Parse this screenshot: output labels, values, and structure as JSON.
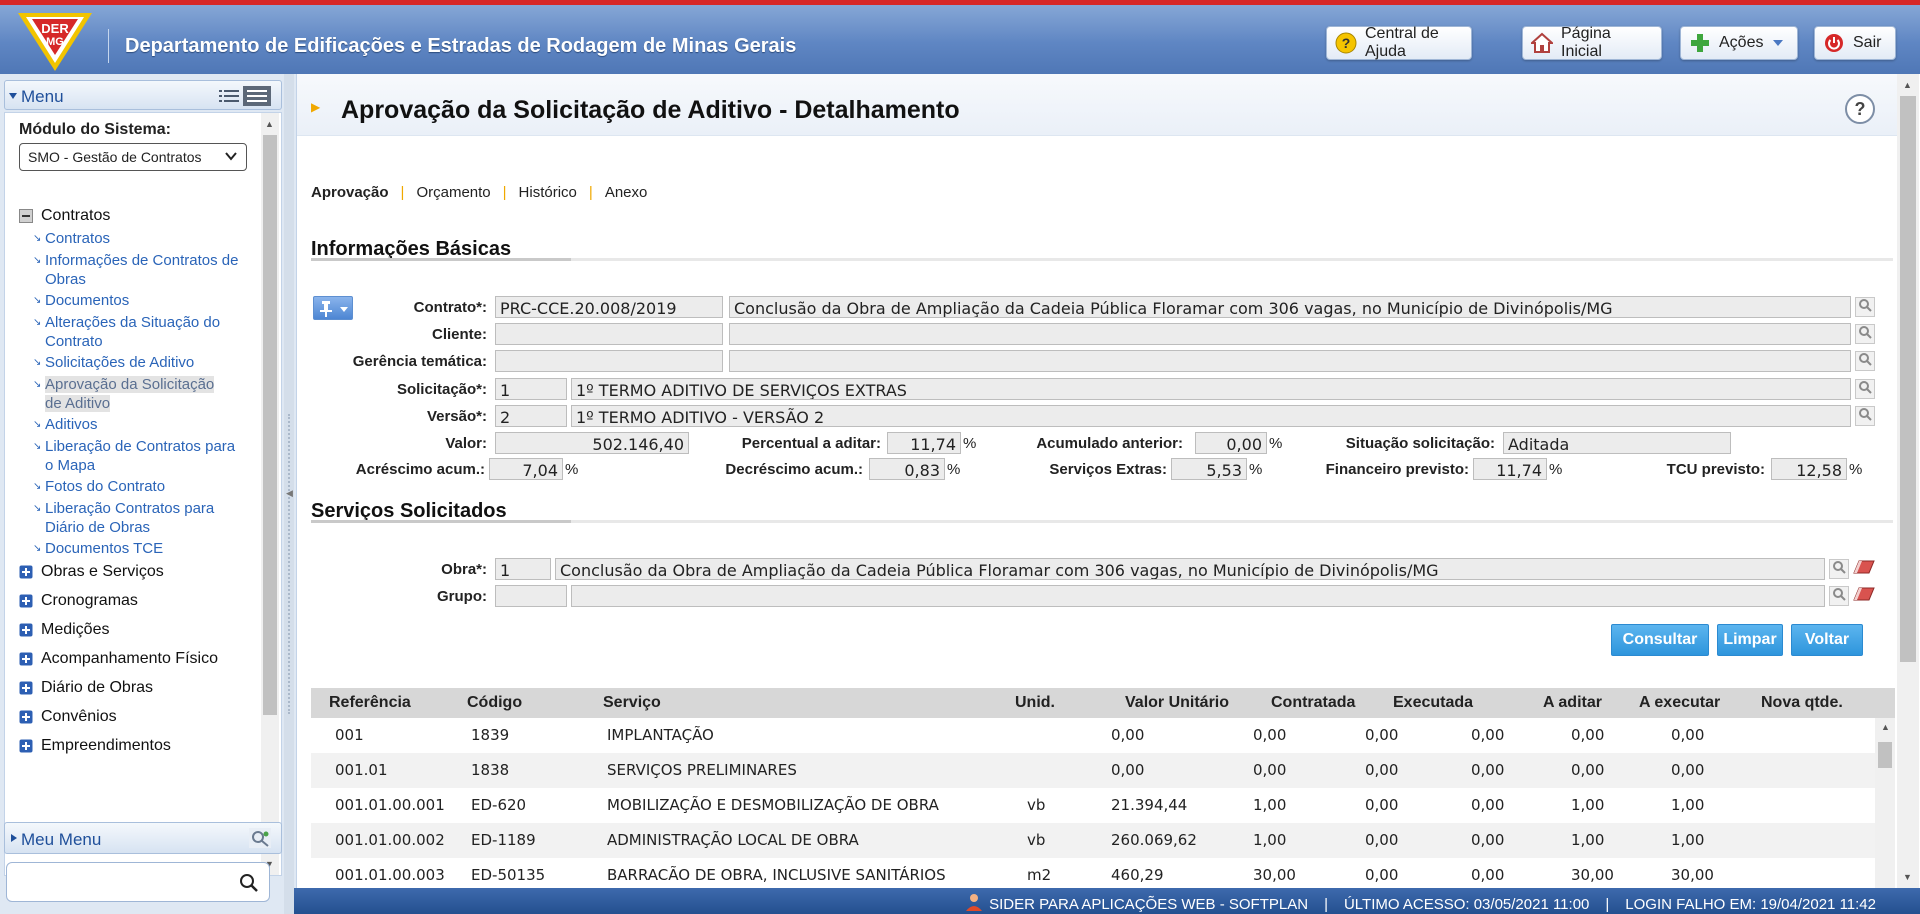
{
  "header": {
    "logo_text_top": "DER",
    "logo_text_bottom": "MG",
    "title": "Departamento de Edificações e Estradas de Rodagem de Minas Gerais",
    "buttons": {
      "help": "Central de Ajuda",
      "home": "Página Inicial",
      "actions": "Ações",
      "logout": "Sair"
    }
  },
  "sidebar": {
    "menu_title": "Menu",
    "module_label": "Módulo do Sistema:",
    "module_value": "SMO - Gestão de Contratos",
    "categories": {
      "contratos": "Contratos",
      "obras": "Obras e Serviços",
      "cronogramas": "Cronogramas",
      "medicoes": "Medições",
      "acompanhamento": "Acompanhamento Físico",
      "diario": "Diário de Obras",
      "convenios": "Convênios",
      "empreendimentos": "Empreendimentos"
    },
    "items": [
      "Contratos",
      "Informações de Contratos de Obras",
      "Documentos",
      "Alterações da Situação do Contrato",
      "Solicitações de Aditivo",
      "Aprovação da Solicitação de Aditivo",
      "Aditivos",
      "Liberação de Contratos para o Mapa",
      "Fotos do Contrato",
      "Liberação Contratos para Diário de Obras",
      "Documentos TCE"
    ],
    "meu_menu": "Meu Menu",
    "search_placeholder": ""
  },
  "page": {
    "title": "Aprovação da Solicitação de Aditivo - Detalhamento",
    "help": "?",
    "tabs": [
      "Aprovação",
      "Orçamento",
      "Histórico",
      "Anexo"
    ],
    "section_basic": "Informações Básicas",
    "section_services": "Serviços Solicitados"
  },
  "form": {
    "contrato_label": "Contrato*:",
    "contrato_code": "PRC-CCE.20.008/2019",
    "contrato_desc": "Conclusão da Obra de Ampliação da Cadeia Pública Floramar com 306 vagas, no Município de Divinópolis/MG",
    "cliente_label": "Cliente:",
    "gerencia_label": "Gerência temática:",
    "solicitacao_label": "Solicitação*:",
    "solicitacao_num": "1",
    "solicitacao_desc": "1º TERMO ADITIVO DE SERVIÇOS EXTRAS",
    "versao_label": "Versão*:",
    "versao_num": "2",
    "versao_desc": "1º TERMO ADITIVO - VERSÃO 2",
    "valor_label": "Valor:",
    "valor": "502.146,40",
    "percentual_label": "Percentual a aditar:",
    "percentual": "11,74",
    "acumulado_label": "Acumulado anterior:",
    "acumulado": "0,00",
    "situacao_label": "Situação solicitação:",
    "situacao": "Aditada",
    "acrescimo_label": "Acréscimo acum.:",
    "acrescimo": "7,04",
    "decrescimo_label": "Decréscimo acum.:",
    "decrescimo": "0,83",
    "servicos_label": "Serviços Extras:",
    "servicos": "5,53",
    "financeiro_label": "Financeiro previsto:",
    "financeiro": "11,74",
    "tcu_label": "TCU previsto:",
    "tcu": "12,58",
    "pct_sign": "%",
    "obra_label": "Obra*:",
    "obra_num": "1",
    "obra_desc": "Conclusão da Obra de Ampliação da Cadeia Pública Floramar com 306 vagas, no Município de Divinópolis/MG",
    "grupo_label": "Grupo:",
    "btn_consultar": "Consultar",
    "btn_limpar": "Limpar",
    "btn_voltar": "Voltar"
  },
  "table": {
    "headers": [
      "Referência",
      "Código",
      "Serviço",
      "Unid.",
      "Valor Unitário",
      "Contratada",
      "Executada",
      "A aditar",
      "A executar",
      "Nova qtde."
    ],
    "rows": [
      [
        "001",
        "1839",
        "IMPLANTAÇÃO",
        "",
        "0,00",
        "0,00",
        "0,00",
        "0,00",
        "0,00",
        "0,00"
      ],
      [
        "001.01",
        "1838",
        "SERVIÇOS PRELIMINARES",
        "",
        "0,00",
        "0,00",
        "0,00",
        "0,00",
        "0,00",
        "0,00"
      ],
      [
        "001.01.00.001",
        "ED-620",
        "MOBILIZAÇÃO E DESMOBILIZAÇÃO DE OBRA",
        "vb",
        "21.394,44",
        "1,00",
        "0,00",
        "0,00",
        "1,00",
        "1,00"
      ],
      [
        "001.01.00.002",
        "ED-1189",
        "ADMINISTRAÇÃO LOCAL DE OBRA",
        "vb",
        "260.069,62",
        "1,00",
        "0,00",
        "0,00",
        "1,00",
        "1,00"
      ],
      [
        "001.01.00.003",
        "ED-50135",
        "BARRACÃO DE OBRA, INCLUSIVE SANITÁRIOS",
        "m2",
        "460,29",
        "30,00",
        "0,00",
        "0,00",
        "30,00",
        "30,00"
      ]
    ]
  },
  "footer": {
    "system": "SIDER PARA APLICAÇÕES WEB - SOFTPLAN",
    "sep": "|",
    "last_access": "ÚLTIMO ACESSO: 03/05/2021 11:00",
    "failed_login": "LOGIN FALHO EM: 19/04/2021 11:42"
  }
}
